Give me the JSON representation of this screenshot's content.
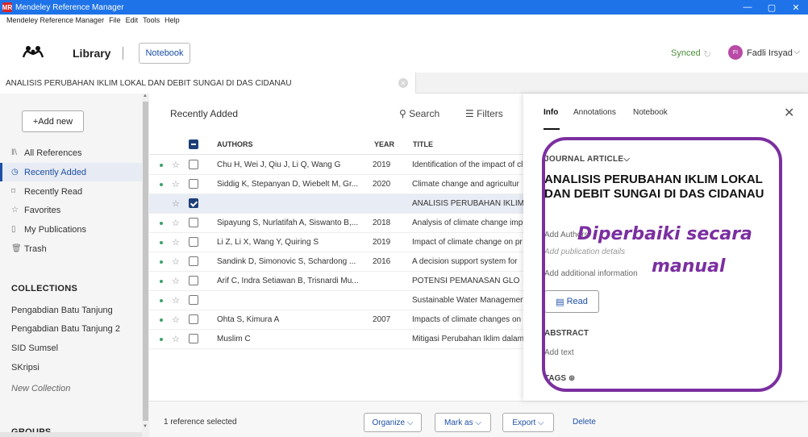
{
  "window": {
    "title": "Mendeley Reference Manager",
    "logo": "MR",
    "controls": [
      "—",
      "▢",
      "✕"
    ]
  },
  "menu": [
    "Mendeley Reference Manager",
    "File",
    "Edit",
    "Tools",
    "Help"
  ],
  "header": {
    "library": "Library",
    "notebook": "Notebook",
    "synced": "Synced",
    "avatar_initials": "FI",
    "user": "Fadli Irsyad"
  },
  "open_tab": {
    "label": "ANALISIS PERUBAHAN IKLIM LOKAL DAN DEBIT SUNGAI DI DAS CIDANAU"
  },
  "sidebar": {
    "add_new": "+Add new",
    "nav": [
      {
        "label": "All References",
        "icon": "library-icon"
      },
      {
        "label": "Recently Added",
        "icon": "clock-icon"
      },
      {
        "label": "Recently Read",
        "icon": "bookmark-icon"
      },
      {
        "label": "Favorites",
        "icon": "star-icon"
      },
      {
        "label": "My Publications",
        "icon": "publication-icon"
      },
      {
        "label": "Trash",
        "icon": "trash-icon"
      }
    ],
    "collections_title": "COLLECTIONS",
    "collections": [
      "Pengabdian Batu Tanjung",
      "Pengabdian Batu Tanjung 2",
      "SID Sumsel",
      "SKripsi"
    ],
    "new_collection": "New Collection",
    "groups_title": "GROUPS"
  },
  "list": {
    "heading": "Recently Added",
    "search": "Search",
    "filters": "Filters",
    "columns": {
      "authors": "AUTHORS",
      "year": "YEAR",
      "title": "TITLE"
    },
    "rows": [
      {
        "dot": true,
        "authors": "Chu H, Wei J, Qiu J, Li Q, Wang G",
        "year": "2019",
        "title": "Identification of the impact of cl",
        "selected": false
      },
      {
        "dot": true,
        "authors": "Siddig K, Stepanyan D, Wiebelt M, Gr...",
        "year": "2020",
        "title": "Climate change and agricultur",
        "selected": false
      },
      {
        "dot": false,
        "authors": "",
        "year": "",
        "title": "ANALISIS PERUBAHAN IKLIM",
        "selected": true
      },
      {
        "dot": true,
        "authors": "Sipayung S, Nurlatifah A, Siswanto B,...",
        "year": "2018",
        "title": "Analysis of climate change imp",
        "selected": false
      },
      {
        "dot": true,
        "authors": "Li Z, Li X, Wang Y, Quiring S",
        "year": "2019",
        "title": "Impact of climate change on pr",
        "selected": false
      },
      {
        "dot": true,
        "authors": "Sandink D, Simonovic S, Schardong ...",
        "year": "2016",
        "title": "A decision support system for",
        "selected": false
      },
      {
        "dot": true,
        "authors": "Arif C, Indra Setiawan B, Trisnardi Mu...",
        "year": "",
        "title": "POTENSI PEMANASAN GLO",
        "selected": false
      },
      {
        "dot": true,
        "authors": "",
        "year": "",
        "title": "Sustainable Water Managemen",
        "selected": false
      },
      {
        "dot": true,
        "authors": "Ohta S, Kimura A",
        "year": "2007",
        "title": "Impacts of climate changes on",
        "selected": false
      },
      {
        "dot": true,
        "authors": "Muslim C",
        "year": "",
        "title": "Mitigasi Perubahan Iklim dalam",
        "selected": false
      }
    ]
  },
  "bottom": {
    "selected": "1 reference selected",
    "organize": "Organize",
    "mark_as": "Mark as",
    "export": "Export",
    "delete": "Delete"
  },
  "info": {
    "tabs": [
      "Info",
      "Annotations",
      "Notebook"
    ],
    "doc_type": "JOURNAL ARTICLE",
    "title": "ANALISIS PERUBAHAN IKLIM LOKAL DAN DEBIT SUNGAI DI DAS CIDANAU",
    "add_authors": "Add Authors",
    "add_pub": "Add publication details",
    "add_info": "Add additional information",
    "read": "Read",
    "abstract": "ABSTRACT",
    "add_text": "Add text",
    "tags": "TAGS"
  },
  "annotation": {
    "line1": "Diperbaiki secara",
    "line2": "manual",
    "color": "#7b2fa0"
  }
}
